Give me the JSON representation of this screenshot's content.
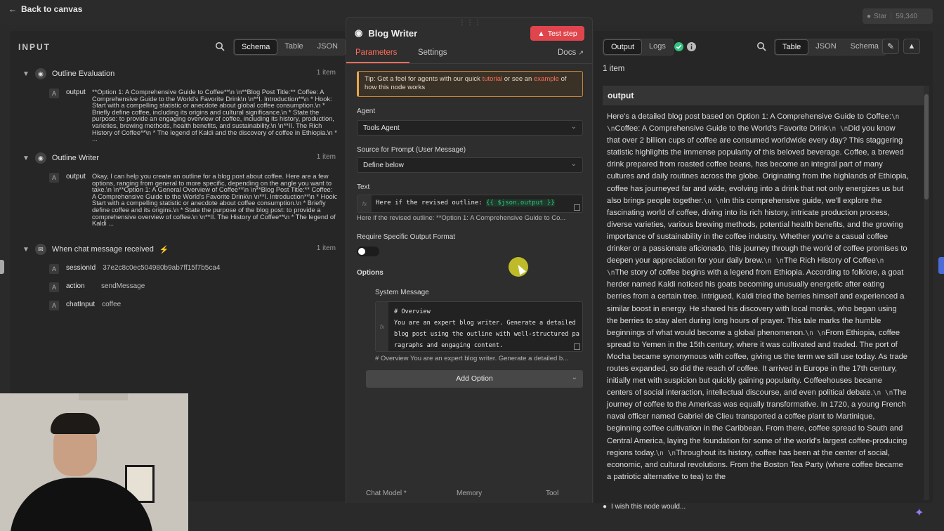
{
  "topbar": {
    "back_label": "Back to canvas",
    "star_label": "Star",
    "star_count": "59,340"
  },
  "input_panel": {
    "title": "INPUT",
    "view_tabs": [
      "Schema",
      "Table",
      "JSON"
    ],
    "active_view": "Schema",
    "nodes": [
      {
        "name": "Outline Evaluation",
        "count": "1 item",
        "fields": [
          {
            "type": "A",
            "key": "output",
            "value": "**Option 1: A Comprehensive Guide to Coffee**\\n \\n**Blog Post Title:** Coffee: A Comprehensive Guide to the World's Favorite Drink\\n \\n**I. Introduction**\\n * Hook: Start with a compelling statistic or anecdote about global coffee consumption.\\n * Briefly define coffee, including its origins and cultural significance.\\n * State the purpose: to provide an engaging overview of coffee, including its history, production, varieties, brewing methods, health benefits, and sustainability.\\n \\n**II. The Rich History of Coffee**\\n * The legend of Kaldi and the discovery of coffee in Ethiopia.\\n * ..."
          }
        ]
      },
      {
        "name": "Outline Writer",
        "count": "1 item",
        "fields": [
          {
            "type": "A",
            "key": "output",
            "value": "Okay, I can help you create an outline for a blog post about coffee. Here are a few options, ranging from general to more specific, depending on the angle you want to take.\\n \\n**Option 1: A General Overview of Coffee**\\n \\n**Blog Post Title:** Coffee: A Comprehensive Guide to the World's Favorite Drink\\n \\n**I. Introduction**\\n * Hook: Start with a compelling statistic or anecdote about coffee consumption.\\n * Briefly define coffee and its origins.\\n * State the purpose of the blog post: to provide a comprehensive overview of coffee.\\n \\n**II. The History of Coffee**\\n * The legend of Kaldi ..."
          }
        ]
      },
      {
        "name": "When chat message received",
        "count": "1 item",
        "fields": [
          {
            "type": "A",
            "key": "sessionId",
            "value": "37e2c8c0ec504980b9ab7ff15f7b5ca4"
          },
          {
            "type": "A",
            "key": "action",
            "value": "sendMessage"
          },
          {
            "type": "A",
            "key": "chatInput",
            "value": "coffee"
          }
        ]
      }
    ]
  },
  "node_panel": {
    "title": "Blog Writer",
    "test_label": "Test step",
    "tabs": [
      "Parameters",
      "Settings"
    ],
    "active_tab": "Parameters",
    "docs_label": "Docs",
    "tip": {
      "prefix": "Tip: Get a feel for agents with our quick",
      "link1": "tutorial",
      "middle": "or see an",
      "link2": "example",
      "suffix": "of how this node works"
    },
    "agent_label": "Agent",
    "agent_value": "Tools Agent",
    "source_label": "Source for Prompt (User Message)",
    "source_value": "Define below",
    "text_label": "Text",
    "text_expr_prefix": "Here if the revised outline:",
    "text_expr_var": "{{ $json.output }}",
    "text_preview": "Here if the revised outline: **Option 1: A Comprehensive Guide to Co...",
    "require_label": "Require Specific Output Format",
    "require_value": false,
    "options_label": "Options",
    "system_label": "System Message",
    "system_code": "# Overview\nYou are an expert blog writer. Generate a detailed blog post using the outline with well-structured paragraphs and engaging content.",
    "system_preview": "# Overview You are an expert blog writer. Generate a detailed b...",
    "add_option_label": "Add Option",
    "sub_nodes": [
      "Chat Model *",
      "Memory",
      "Tool"
    ]
  },
  "output_panel": {
    "tabs": [
      "Output",
      "Logs"
    ],
    "active_tab": "Output",
    "view_tabs": [
      "Table",
      "JSON",
      "Schema"
    ],
    "active_view": "Table",
    "item_count": "1 item",
    "column_header": "output",
    "text_segments": [
      "Here's a detailed blog post based on Option 1: A Comprehensive Guide to Coffee:",
      "Coffee: A Comprehensive Guide to the World's Favorite Drink",
      "Did you know that over 2 billion cups of coffee are consumed worldwide every day? This staggering statistic highlights the immense popularity of this beloved beverage. Coffee, a brewed drink prepared from roasted coffee beans, has become an integral part of many cultures and daily routines across the globe. Originating from the highlands of Ethiopia, coffee has journeyed far and wide, evolving into a drink that not only energizes us but also brings people together.",
      "In this comprehensive guide, we'll explore the fascinating world of coffee, diving into its rich history, intricate production process, diverse varieties, various brewing methods, potential health benefits, and the growing importance of sustainability in the coffee industry. Whether you're a casual coffee drinker or a passionate aficionado, this journey through the world of coffee promises to deepen your appreciation for your daily brew.",
      "The Rich History of Coffee",
      "The story of coffee begins with a legend from Ethiopia. According to folklore, a goat herder named Kaldi noticed his goats becoming unusually energetic after eating berries from a certain tree. Intrigued, Kaldi tried the berries himself and experienced a similar boost in energy. He shared his discovery with local monks, who began using the berries to stay alert during long hours of prayer. This tale marks the humble beginnings of what would become a global phenomenon.",
      "From Ethiopia, coffee spread to Yemen in the 15th century, where it was cultivated and traded. The port of Mocha became synonymous with coffee, giving us the term we still use today. As trade routes expanded, so did the reach of coffee. It arrived in Europe in the 17th century, initially met with suspicion but quickly gaining popularity. Coffeehouses became centers of social interaction, intellectual discourse, and even political debate.",
      "The journey of coffee to the Americas was equally transformative. In 1720, a young French naval officer named Gabriel de Clieu transported a coffee plant to Martinique, beginning coffee cultivation in the Caribbean. From there, coffee spread to South and Central America, laying the foundation for some of the world's largest coffee-producing regions today.",
      "Throughout its history, coffee has been at the center of social, economic, and cultural revolutions. From the Boston Tea Party (where coffee became a patriotic alternative to tea) to the"
    ],
    "newline_token": "\\n \\n"
  },
  "footer": {
    "wish_label": "I wish this node would..."
  },
  "colors": {
    "accent": "#ff6d5a",
    "test_button": "#e0454d",
    "success": "#33c27f",
    "tip_border": "#e7a64d"
  }
}
